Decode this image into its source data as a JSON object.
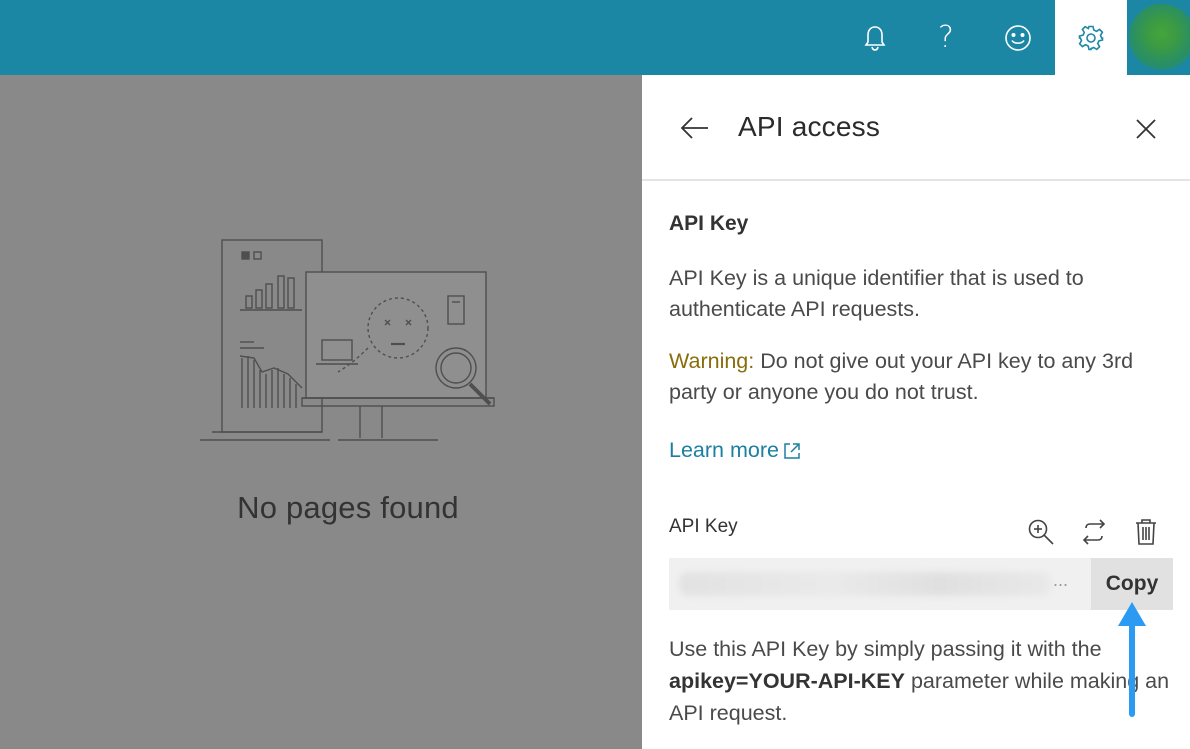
{
  "topbar": {
    "icons": [
      "bell-icon",
      "help-icon",
      "smiley-icon",
      "gear-icon"
    ],
    "help_glyph": "?",
    "bg_color": "#1b87a4",
    "active_icon": "gear-icon"
  },
  "main": {
    "empty_state_text": "No pages found"
  },
  "panel": {
    "title": "API access",
    "section_title": "API Key",
    "description": "API Key is a unique identifier that is used to authenticate API requests.",
    "warning_label": "Warning:",
    "warning_text": " Do not give out your API key to any 3rd party or anyone you do not trust.",
    "learn_more": "Learn more",
    "key_label": "API Key",
    "key_value_ellipsis": "...",
    "copy_label": "Copy",
    "usage_prefix": "Use this API Key by simply passing it with the ",
    "usage_param": "apikey=YOUR-API-KEY",
    "usage_suffix": " parameter while making an API request.",
    "link_color": "#1b7fa0",
    "warning_color": "#8a6d0b",
    "annotation_arrow_color": "#2b9af3"
  }
}
